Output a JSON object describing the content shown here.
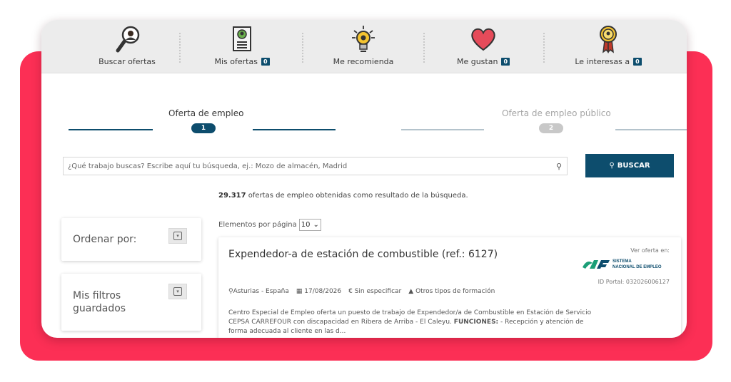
{
  "nav": {
    "items": [
      {
        "label": "Buscar ofertas",
        "badge": "",
        "icon": "magnifier-person-icon"
      },
      {
        "label": "Mis ofertas",
        "badge": "0",
        "icon": "document-person-icon"
      },
      {
        "label": "Me recomienda",
        "badge": "",
        "icon": "lightbulb-person-icon"
      },
      {
        "label": "Me gustan",
        "badge": "0",
        "icon": "heart-icon"
      },
      {
        "label": "Le interesas a",
        "badge": "0",
        "icon": "medal-person-icon"
      }
    ]
  },
  "steps": [
    {
      "label": "Oferta de empleo",
      "number": "1",
      "state": "active"
    },
    {
      "label": "Oferta de empleo público",
      "number": "2",
      "state": "inactive"
    }
  ],
  "search": {
    "placeholder": "¿Qué trabajo buscas? Escribe aquí tu búsqueda, ej.: Mozo de almacén, Madrid",
    "button_label": "BUSCAR"
  },
  "results": {
    "count": "29.317",
    "text": " ofertas de empleo obtenidas como resultado de la búsqueda."
  },
  "sidebar": {
    "order_label": "Ordenar por:",
    "filters_label": "Mis filtros guardados"
  },
  "pagination": {
    "label": "Elementos por página",
    "value": "10"
  },
  "job": {
    "title": "Expendedor-a de estación de combustible (ref.: 6127)",
    "view_label": "Ver oferta en:",
    "source_line1": "SISTEMA",
    "source_line2": "NACIONAL DE EMPLEO",
    "portal_id": "ID Portal: 032026006127",
    "location": "Asturias - España",
    "date": "17/08/2026",
    "salary": "Sin especificar",
    "education": "Otros tipos de formación",
    "desc_line1": "Centro Especial de Empleo oferta un puesto de trabajo de Expendedor/a de Combustible en Estación de Servicio",
    "desc_line2": "CEPSA CARREFOUR con discapacidad en Ribera de Arriba - El Caleyu.",
    "desc_funciones": "FUNCIONES:",
    "desc_line2b": " - Recepción y atención de",
    "desc_line3": "forma adecuada al cliente en las d..."
  },
  "colors": {
    "accent": "#0d4d6d",
    "frame": "#fc2f55",
    "nav_bg": "#ececec"
  }
}
